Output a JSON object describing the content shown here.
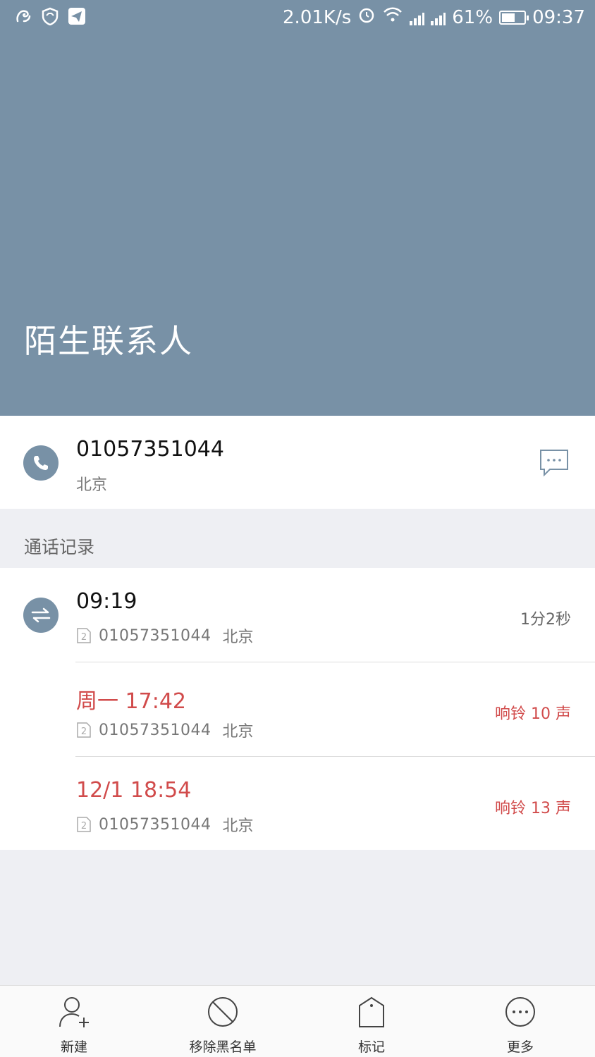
{
  "status_bar": {
    "speed": "2.01K/s",
    "battery_level": "61%",
    "battery_fraction": 0.61,
    "time": "09:37",
    "left_icons": [
      "uc-squirrel-icon",
      "shield-icon",
      "telegram-icon"
    ],
    "right_icons": [
      "alarm-icon",
      "wifi-icon",
      "signal-icon",
      "signal-icon",
      "battery-icon"
    ]
  },
  "header": {
    "title": "陌生联系人",
    "color": "#7891a6"
  },
  "primary": {
    "number": "01057351044",
    "location": "北京",
    "icon": "phone-icon",
    "action_icon": "message-icon"
  },
  "call_log": {
    "title": "通话记录",
    "entries": [
      {
        "time": "09:19",
        "number": "01057351044",
        "location": "北京",
        "meta": "1分2秒",
        "missed": false,
        "sim": "2"
      },
      {
        "time": "周一 17:42",
        "number": "01057351044",
        "location": "北京",
        "meta": "响铃 10 声",
        "missed": true,
        "sim": "2"
      },
      {
        "time": "12/1 18:54",
        "number": "01057351044",
        "location": "北京",
        "meta": "响铃 13 声",
        "missed": true,
        "sim": "2"
      }
    ],
    "missed_color": "#d14b4b"
  },
  "bottom_bar": {
    "new": "新建",
    "remove_blacklist": "移除黑名单",
    "mark": "标记",
    "more": "更多"
  }
}
